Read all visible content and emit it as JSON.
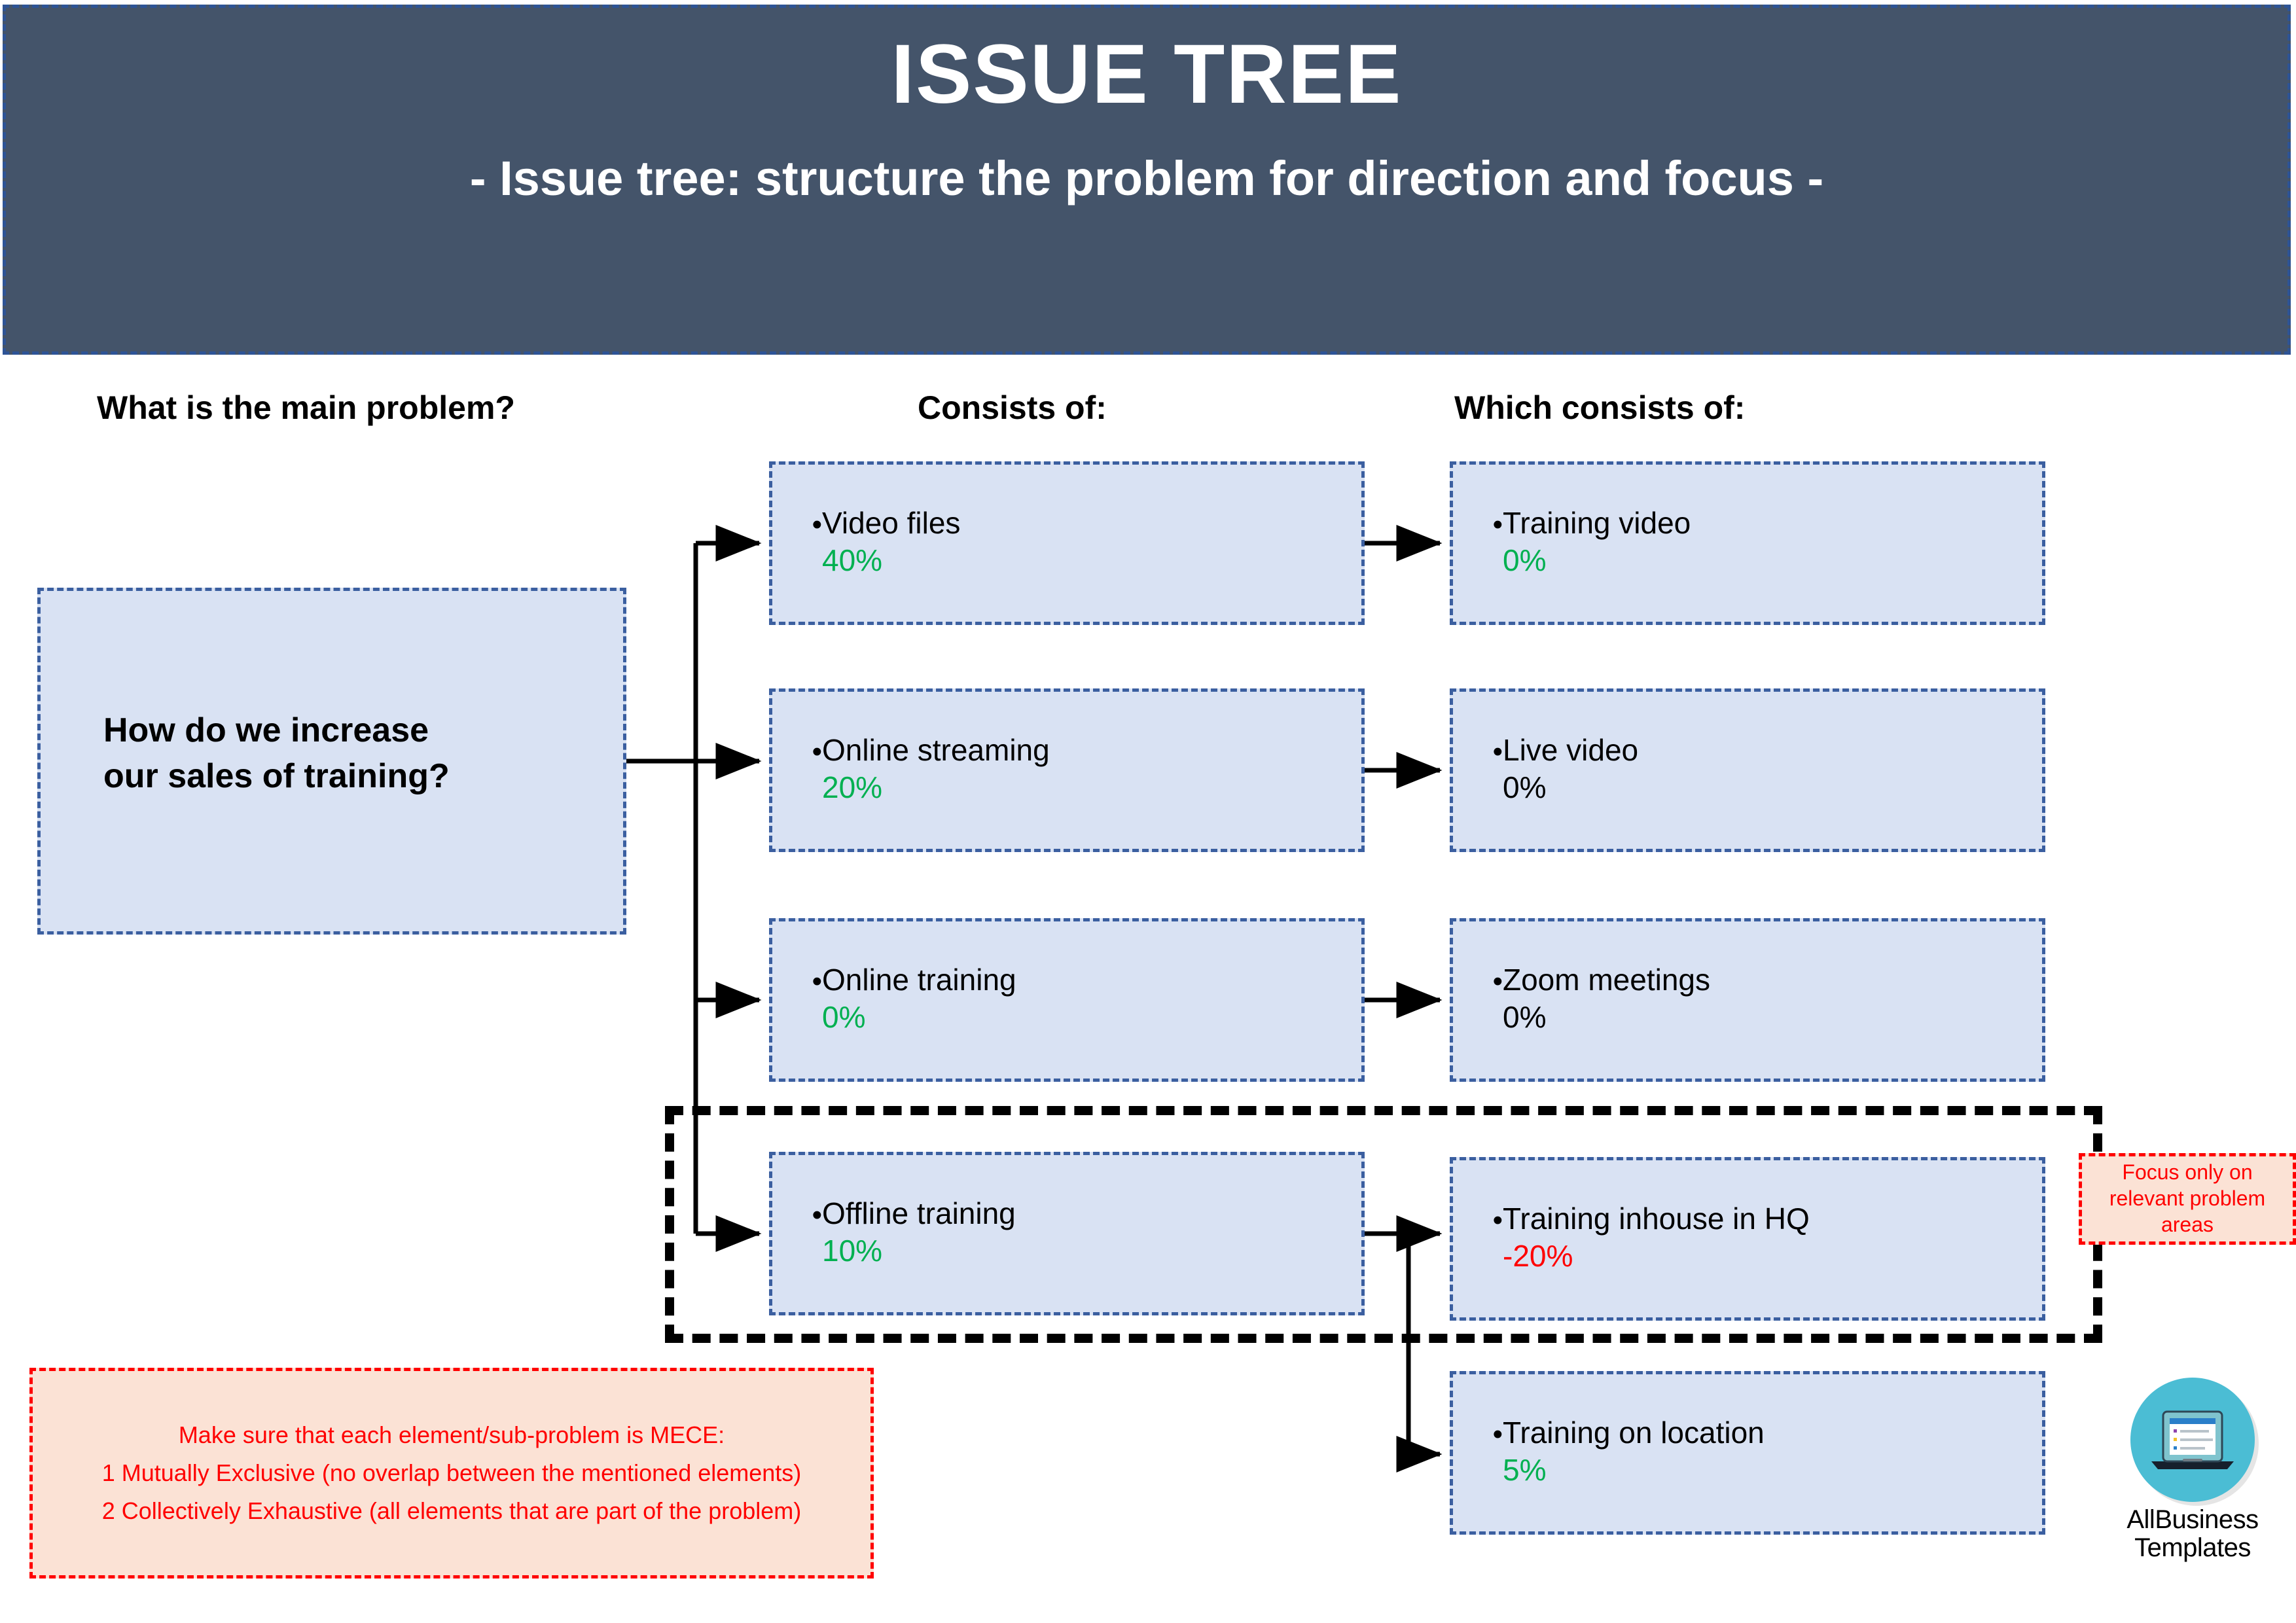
{
  "header": {
    "title": "ISSUE TREE",
    "subtitle": "- Issue tree: structure the problem for direction and focus -",
    "background_color": "#44546A",
    "border_color": "#2E5496"
  },
  "columns": [
    {
      "heading": "What is the main problem?"
    },
    {
      "heading": "Consists of:"
    },
    {
      "heading": "Which consists of:"
    }
  ],
  "root": {
    "line1": "How do we increase",
    "line2": "our sales of training?"
  },
  "level2": [
    {
      "bullet": "•",
      "label": "Video files",
      "value": "40%",
      "value_color": "#00B050"
    },
    {
      "bullet": "•",
      "label": "Online streaming",
      "value": "20%",
      "value_color": "#00B050"
    },
    {
      "bullet": "•",
      "label": "Online training",
      "value": "0%",
      "value_color": "#00B050"
    },
    {
      "bullet": "•",
      "label": "Offline training",
      "value": "10%",
      "value_color": "#00B050"
    }
  ],
  "level3": [
    {
      "bullet": "•",
      "label": "Training video",
      "value": "0%",
      "value_color": "#00B050"
    },
    {
      "bullet": "•",
      "label": "Live video",
      "value": "0%",
      "value_color": "#000000"
    },
    {
      "bullet": "•",
      "label": "Zoom meetings",
      "value": "0%",
      "value_color": "#000000"
    },
    {
      "bullet": "•",
      "label": "Training inhouse in HQ",
      "value": "-20%",
      "value_color": "#FF0000"
    },
    {
      "bullet": "•",
      "label": "Training on location",
      "value": "5%",
      "value_color": "#00B050"
    }
  ],
  "callouts": {
    "focus": "Focus only on relevant problem areas",
    "mece_line1": "Make sure that each element/sub-problem is MECE:",
    "mece_line2": "1 Mutually Exclusive (no overlap between the mentioned elements)",
    "mece_line3": "2 Collectively Exhaustive (all elements that are part of the problem)"
  },
  "logo": {
    "line1": "AllBusiness",
    "line2": "Templates",
    "badge_color": "#4BBDD4"
  },
  "colors": {
    "node_fill": "#D9E2F3",
    "node_border": "#3B5FA0",
    "callout_fill": "#FBE2D5",
    "callout_border": "#FF0000",
    "positive": "#00B050",
    "negative": "#FF0000"
  }
}
